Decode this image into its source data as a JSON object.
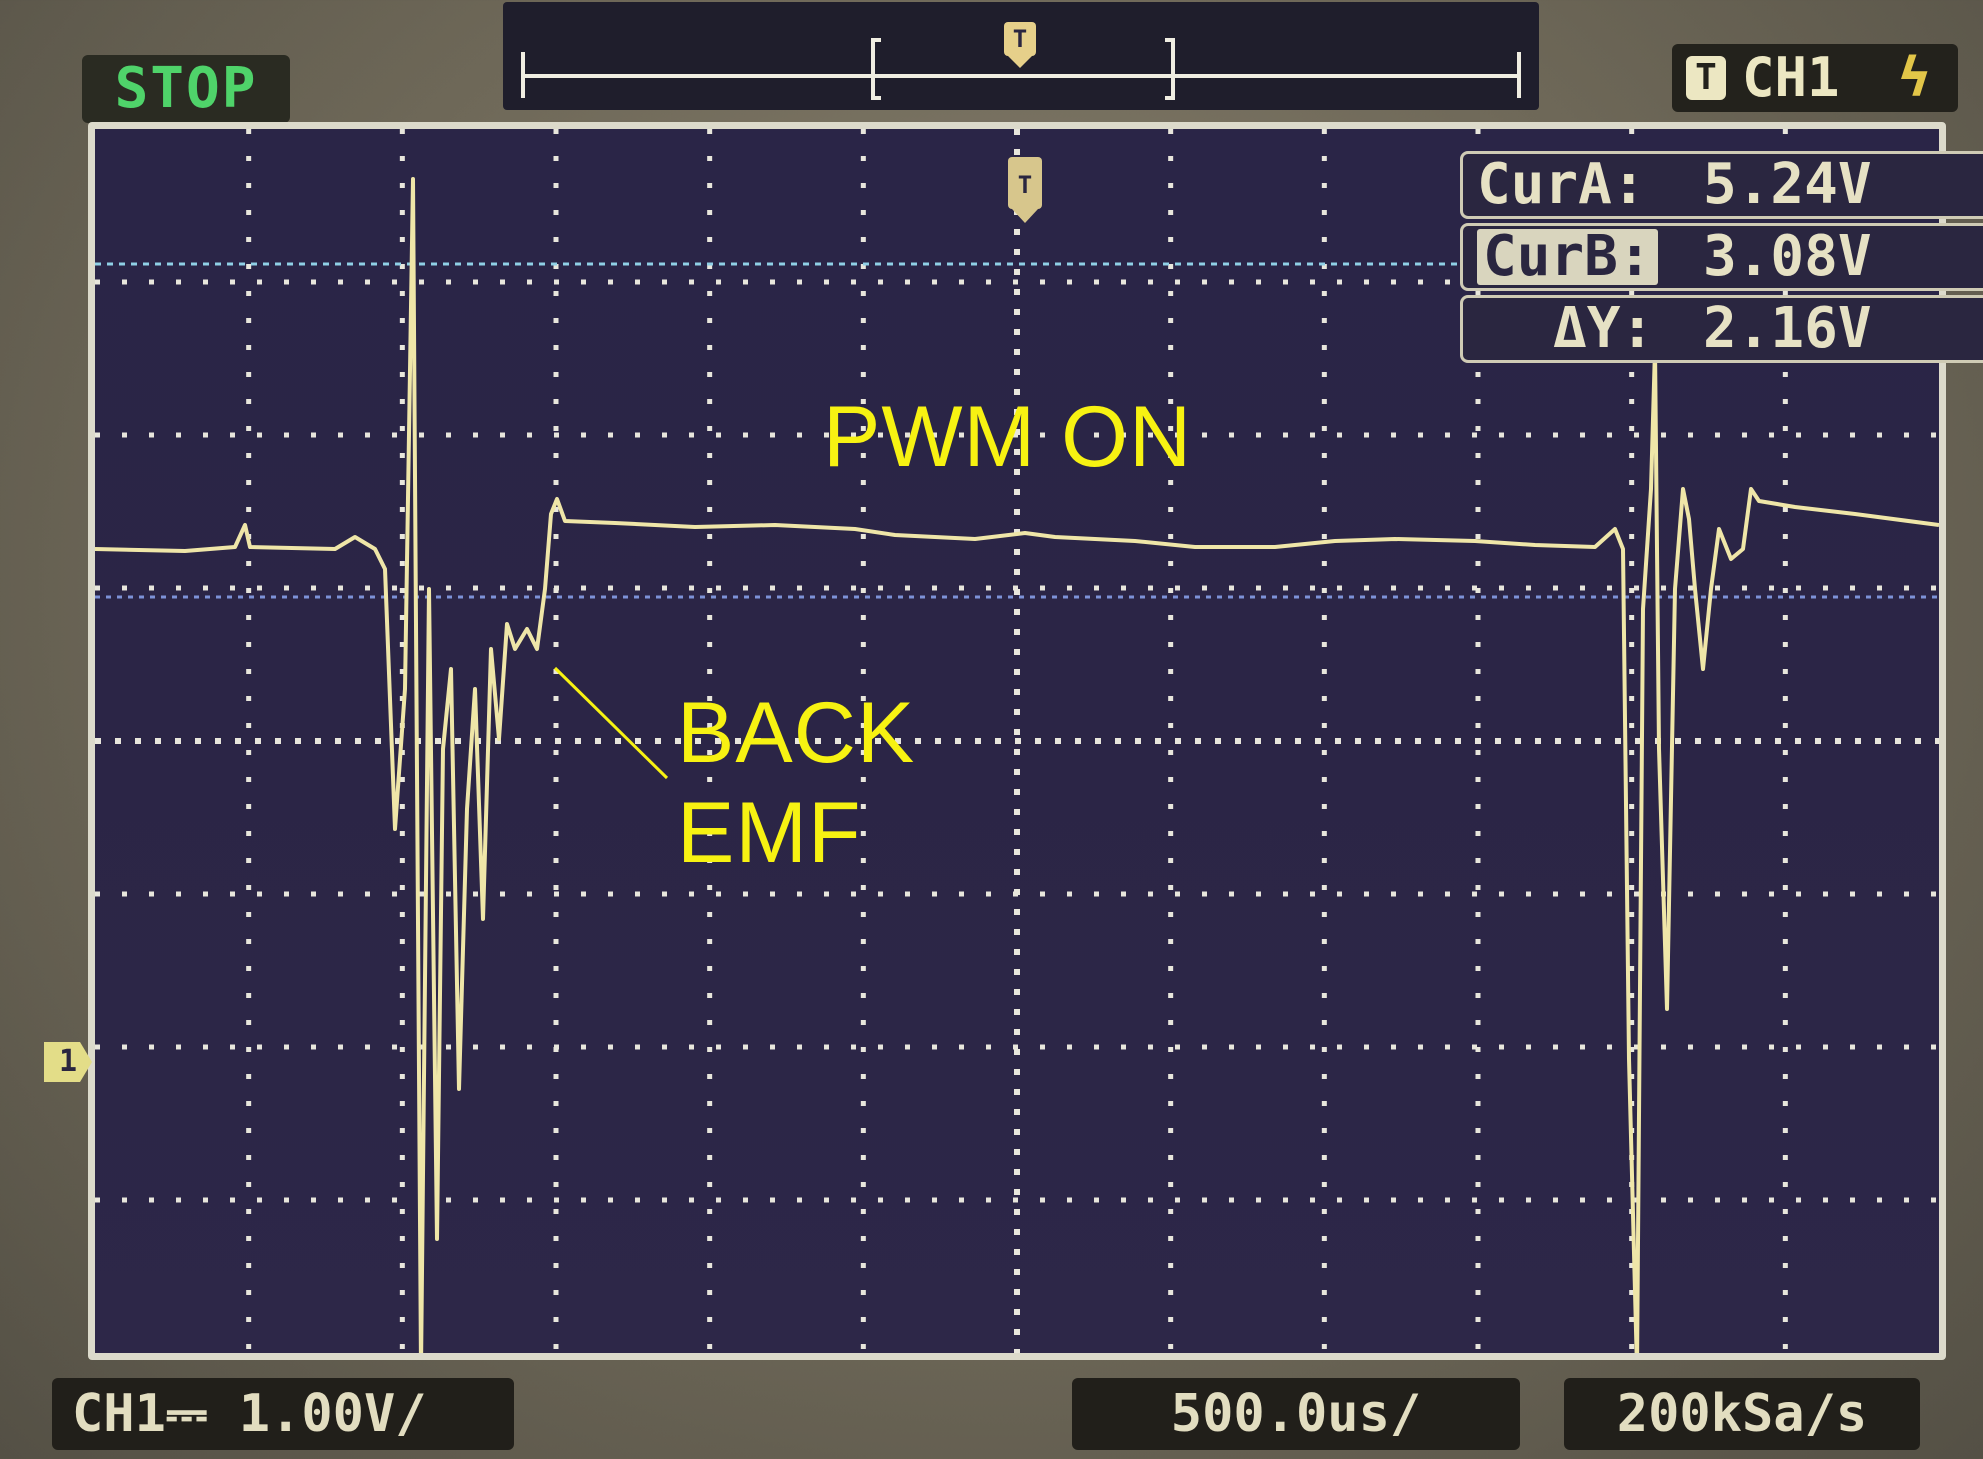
{
  "status": "STOP",
  "trigger": {
    "badge": "T",
    "channel": "CH1",
    "edge_icon": "rising-edge-icon",
    "edge_glyph": "ϟ"
  },
  "timebar": {
    "marker": "T"
  },
  "cursors": {
    "cur_a": {
      "label": "CurA:",
      "value": "5.24V"
    },
    "cur_b": {
      "label": "CurB:",
      "value": "3.08V"
    },
    "delta": {
      "label": "ΔY:",
      "value": "2.16V"
    }
  },
  "annotations": {
    "pwm_on": "PWM ON",
    "back_emf_line1": "BACK",
    "back_emf_line2": "EMF"
  },
  "footer": {
    "channel_scale": "CH1⎓  1.00V/",
    "timebase": "500.0us/",
    "sample_rate": "200kSa/s"
  },
  "channel_marker": "1",
  "colors": {
    "screen_bg": "#2b2546",
    "trace": "#efe6a8",
    "cursor_line": "#8fd0e6",
    "annotation": "#f7f212",
    "status_green": "#4fd36a"
  }
}
